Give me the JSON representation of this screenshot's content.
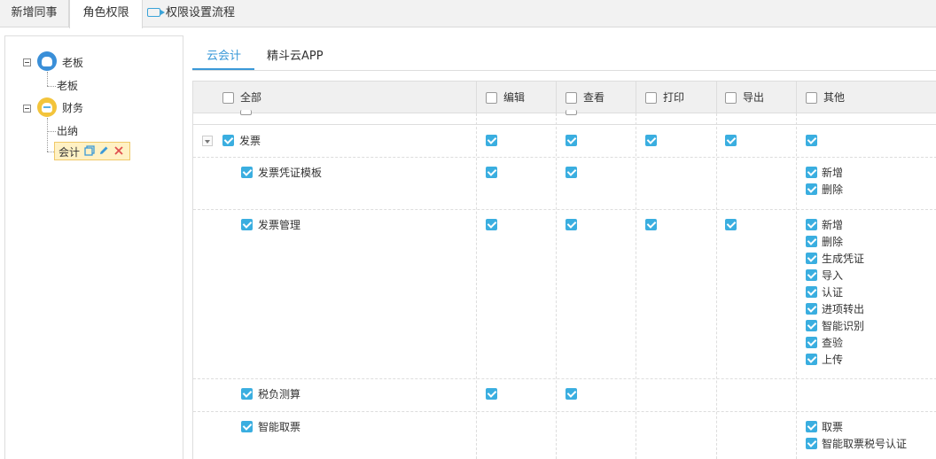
{
  "top_tabs": [
    {
      "label": "新增同事"
    },
    {
      "label": "角色权限"
    },
    {
      "label": "权限设置流程"
    }
  ],
  "tree": {
    "root1": {
      "label": "老板"
    },
    "root1_child": {
      "label": "老板"
    },
    "root2": {
      "label": "财务"
    },
    "root2_children": [
      {
        "label": "出纳"
      },
      {
        "label": "会计"
      }
    ]
  },
  "sub_tabs": [
    {
      "label": "云会计"
    },
    {
      "label": "精斗云APP"
    }
  ],
  "columns": {
    "all": "全部",
    "edit": "编辑",
    "view": "查看",
    "print": "打印",
    "export": "导出",
    "other": "其他"
  },
  "rows": [
    {
      "name": "发票",
      "others": []
    },
    {
      "name": "发票凭证模板",
      "others": [
        "新增",
        "删除"
      ]
    },
    {
      "name": "发票管理",
      "others": [
        "新增",
        "删除",
        "生成凭证",
        "导入",
        "认证",
        "进项转出",
        "智能识别",
        "查验",
        "上传"
      ]
    },
    {
      "name": "税负测算",
      "others": []
    },
    {
      "name": "智能取票",
      "others": [
        "取票",
        "智能取票税号认证"
      ]
    }
  ],
  "colors": {
    "accent": "#3a99d8",
    "checkbox": "#3aaee0",
    "selected_bg": "#fff1c4"
  }
}
